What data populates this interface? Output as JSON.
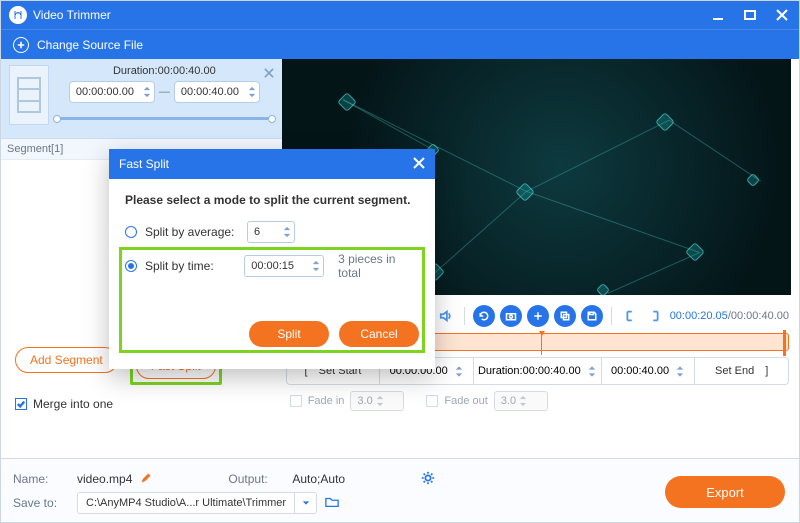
{
  "window": {
    "title": "Video Trimmer"
  },
  "subbar": {
    "change_source_label": "Change Source File"
  },
  "segment": {
    "label": "Segment[1]",
    "duration_label": "Duration:00:00:40.00",
    "start": "00:00:00.00",
    "end": "00:00:40.00"
  },
  "left_actions": {
    "add_segment": "Add Segment",
    "fast_split": "Fast Split",
    "merge_label": "Merge into one",
    "merge_checked": true
  },
  "modal": {
    "title": "Fast Split",
    "prompt": "Please select a mode to split the current segment.",
    "avg_label": "Split by average:",
    "avg_value": "6",
    "avg_selected": false,
    "time_label": "Split by time:",
    "time_value": "00:00:15",
    "time_selected": true,
    "pieces_text": "3 pieces in total",
    "split_btn": "Split",
    "cancel_btn": "Cancel"
  },
  "player": {
    "current": "00:00:20.05",
    "total": "00:00:40.00"
  },
  "setrow": {
    "set_start": "Set Start",
    "start_val": "00:00:00.00",
    "duration_val": "Duration:00:00:40.00",
    "end_val": "00:00:40.00",
    "set_end": "Set End"
  },
  "fade": {
    "in_label": "Fade in",
    "in_val": "3.0",
    "out_label": "Fade out",
    "out_val": "3.0"
  },
  "bottom": {
    "name_label": "Name:",
    "name_value": "video.mp4",
    "output_label": "Output:",
    "output_value": "Auto;Auto",
    "save_label": "Save to:",
    "save_path": "C:\\AnyMP4 Studio\\A...r Ultimate\\Trimmer",
    "export": "Export"
  }
}
